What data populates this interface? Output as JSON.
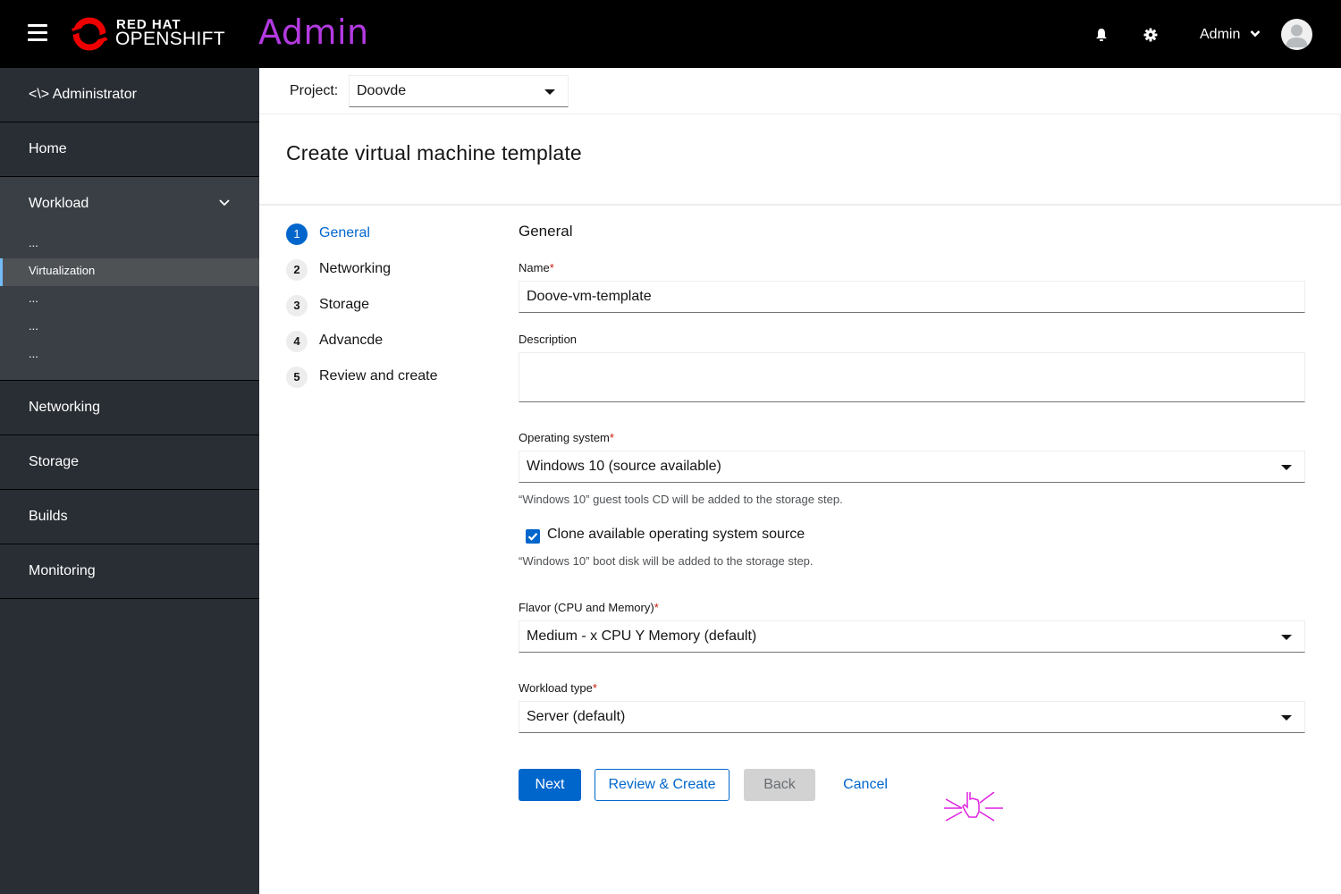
{
  "masthead": {
    "brand_top": "RED HAT",
    "brand_bottom": "OPENSHIFT",
    "app_title": "Admin",
    "user_label": "Admin",
    "icons": [
      "hamburger-menu-icon",
      "bell-icon",
      "gear-icon",
      "chevron-down-icon",
      "avatar-icon"
    ]
  },
  "sidebar": {
    "perspective": "<\\> Administrator",
    "home": "Home",
    "workload": {
      "label": "Workload",
      "items": [
        "...",
        "Virtualization",
        "...",
        "...",
        "..."
      ],
      "active": "Virtualization"
    },
    "networking": "Networking",
    "storage": "Storage",
    "builds": "Builds",
    "monitoring": "Monitoring",
    "accent_color": "#73bcf7"
  },
  "project": {
    "label": "Project:",
    "value": "Doovde"
  },
  "page": {
    "title": "Create virtual machine template"
  },
  "wizard": {
    "steps": [
      {
        "num": "1",
        "label": "General",
        "active": true
      },
      {
        "num": "2",
        "label": "Networking"
      },
      {
        "num": "3",
        "label": "Storage"
      },
      {
        "num": "4",
        "label": "Advancde"
      },
      {
        "num": "5",
        "label": "Review and create"
      }
    ]
  },
  "form": {
    "section_title": "General",
    "name": {
      "label": "Name",
      "required": "*",
      "value": "Doove-vm-template"
    },
    "description": {
      "label": "Description",
      "value": ""
    },
    "os": {
      "label": "Operating system",
      "required": "*",
      "value": "Windows 10 (source available)",
      "helper": "“Windows 10” guest tools CD will be added to the storage step."
    },
    "clone": {
      "label": "Clone available operating system source",
      "checked": true,
      "helper": "“Windows 10” boot disk will be added to the storage step."
    },
    "flavor": {
      "label": "Flavor (CPU and Memory)",
      "required": "*",
      "value": "Medium - x CPU Y Memory (default)"
    },
    "workload": {
      "label": "Workload type",
      "required": "*",
      "value": "Server (default)"
    }
  },
  "buttons": {
    "next": "Next",
    "review": "Review & Create",
    "back": "Back",
    "cancel": "Cancel"
  },
  "colors": {
    "primary": "#0066cc",
    "app_title": "#b33ae0",
    "required": "#c9190b",
    "click_indicator": "#e020e0"
  }
}
